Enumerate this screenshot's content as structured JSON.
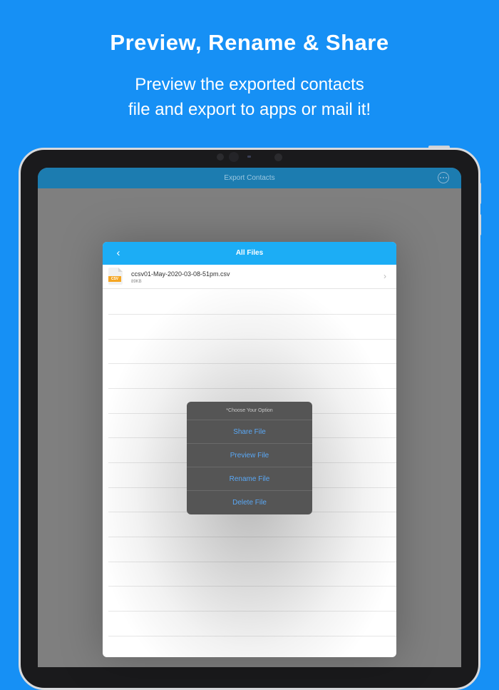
{
  "promo": {
    "headline": "Preview, Rename & Share",
    "subline_1": "Preview the exported contacts",
    "subline_2": "file and export to apps or mail it!"
  },
  "app": {
    "title": "Export Contacts",
    "more_icon": "ellipsis-circle-icon"
  },
  "panel": {
    "title": "All Files",
    "back_icon": "chevron-left-icon",
    "back_glyph": "‹",
    "file": {
      "name": "ccsv01-May-2020-03-08-51pm.csv",
      "size": "89KB",
      "type_tag": "CSV",
      "chevron_glyph": "›"
    }
  },
  "action_sheet": {
    "title": "*Choose Your Option",
    "items": [
      "Share File",
      "Preview File",
      "Rename File",
      "Delete File"
    ]
  },
  "colors": {
    "background": "#1690f5",
    "app_bar": "#1c7cb0",
    "panel_bar": "#1cadf5",
    "sheet_bg": "#555555",
    "sheet_text": "#5aa8f5",
    "csv_tag": "#f5a623"
  }
}
